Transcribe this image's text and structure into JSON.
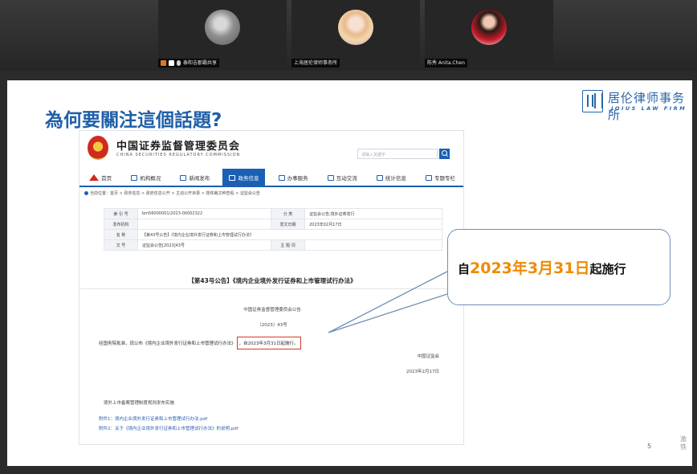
{
  "meeting": {
    "participants": [
      {
        "name": "泰和吉郡霸共享",
        "avatar_icon": "photo-avatar-icon"
      },
      {
        "name": "上海居伦律师事务所",
        "avatar_icon": "anime-avatar-icon"
      },
      {
        "name": "陈秀 Anita.Chen",
        "avatar_icon": "portrait-avatar-icon"
      }
    ]
  },
  "slide": {
    "title": "為何要關注這個話題?",
    "logo_cn": "居伦律师事务所",
    "logo_en": "JOIUS LAW FIRM",
    "page_number": "5",
    "side_text": "激\n铁"
  },
  "web": {
    "site_name_cn": "中国证券监督管理委员会",
    "site_name_en": "CHINA SECURITIES REGULATORY COMMISSION",
    "search_placeholder": "请输入关键字",
    "nav": [
      {
        "label": "首页",
        "icon": "home-icon"
      },
      {
        "label": "机构概况",
        "icon": "building-icon"
      },
      {
        "label": "新闻发布",
        "icon": "news-icon"
      },
      {
        "label": "政务信息",
        "icon": "info-icon",
        "active": true
      },
      {
        "label": "办事服务",
        "icon": "service-icon"
      },
      {
        "label": "互动交流",
        "icon": "chat-icon"
      },
      {
        "label": "统计信息",
        "icon": "stats-icon"
      },
      {
        "label": "专题专栏",
        "icon": "topic-icon"
      }
    ],
    "breadcrumb": "当前位置：首页 > 政务信息 > 政府信息公开 > 主动公开目录 > 按体裁文种查看 > 证监会公告",
    "meta": {
      "index_label": "索 引 号",
      "index_value": "bm56000001/2023-00002322",
      "category_label": "分 类",
      "category_value": "证监会公告;境外证券发行",
      "issuer_label": "发布机构",
      "issuer_value": "",
      "date_label": "发文日期",
      "date_value": "2023年02月17日",
      "name_label": "名 称",
      "name_value": "【第43号公告】《境内企业境外发行证券和上市管理试行办法》",
      "docno_label": "文 号",
      "docno_value": "证监会公告[2023]43号",
      "keyword_label": "主 题 词",
      "keyword_value": ""
    },
    "doc": {
      "title": "【第43号公告】《境内企业境外发行证券和上市管理试行办法》",
      "issuer_line": "中国证券监督管理委员会公告",
      "doc_no": "〔2023〕43号",
      "body_prefix": "经国务院批准，现公布《境内企业境外发行证券和上市管理试行办法》",
      "body_highlight": "，自2023年3月31日起施行。",
      "signature": "中国证监会",
      "date": "2023年2月17日",
      "rule_line": "境外上市备案管理制度规则发布实施",
      "attachments": [
        "附件1：境内企业境外发行证券和上市管理试行办法.pdf",
        "附件2：关于《境内企业境外发行证券和上市管理试行办法》的说明.pdf"
      ]
    }
  },
  "callout": {
    "prefix": "自",
    "date": "2023年3月31日",
    "suffix": "起施行"
  },
  "colors": {
    "title_blue": "#1f5fa8",
    "nav_blue": "#1b5fb3",
    "highlight_red": "#d33b2c",
    "callout_orange": "#f08a00"
  }
}
